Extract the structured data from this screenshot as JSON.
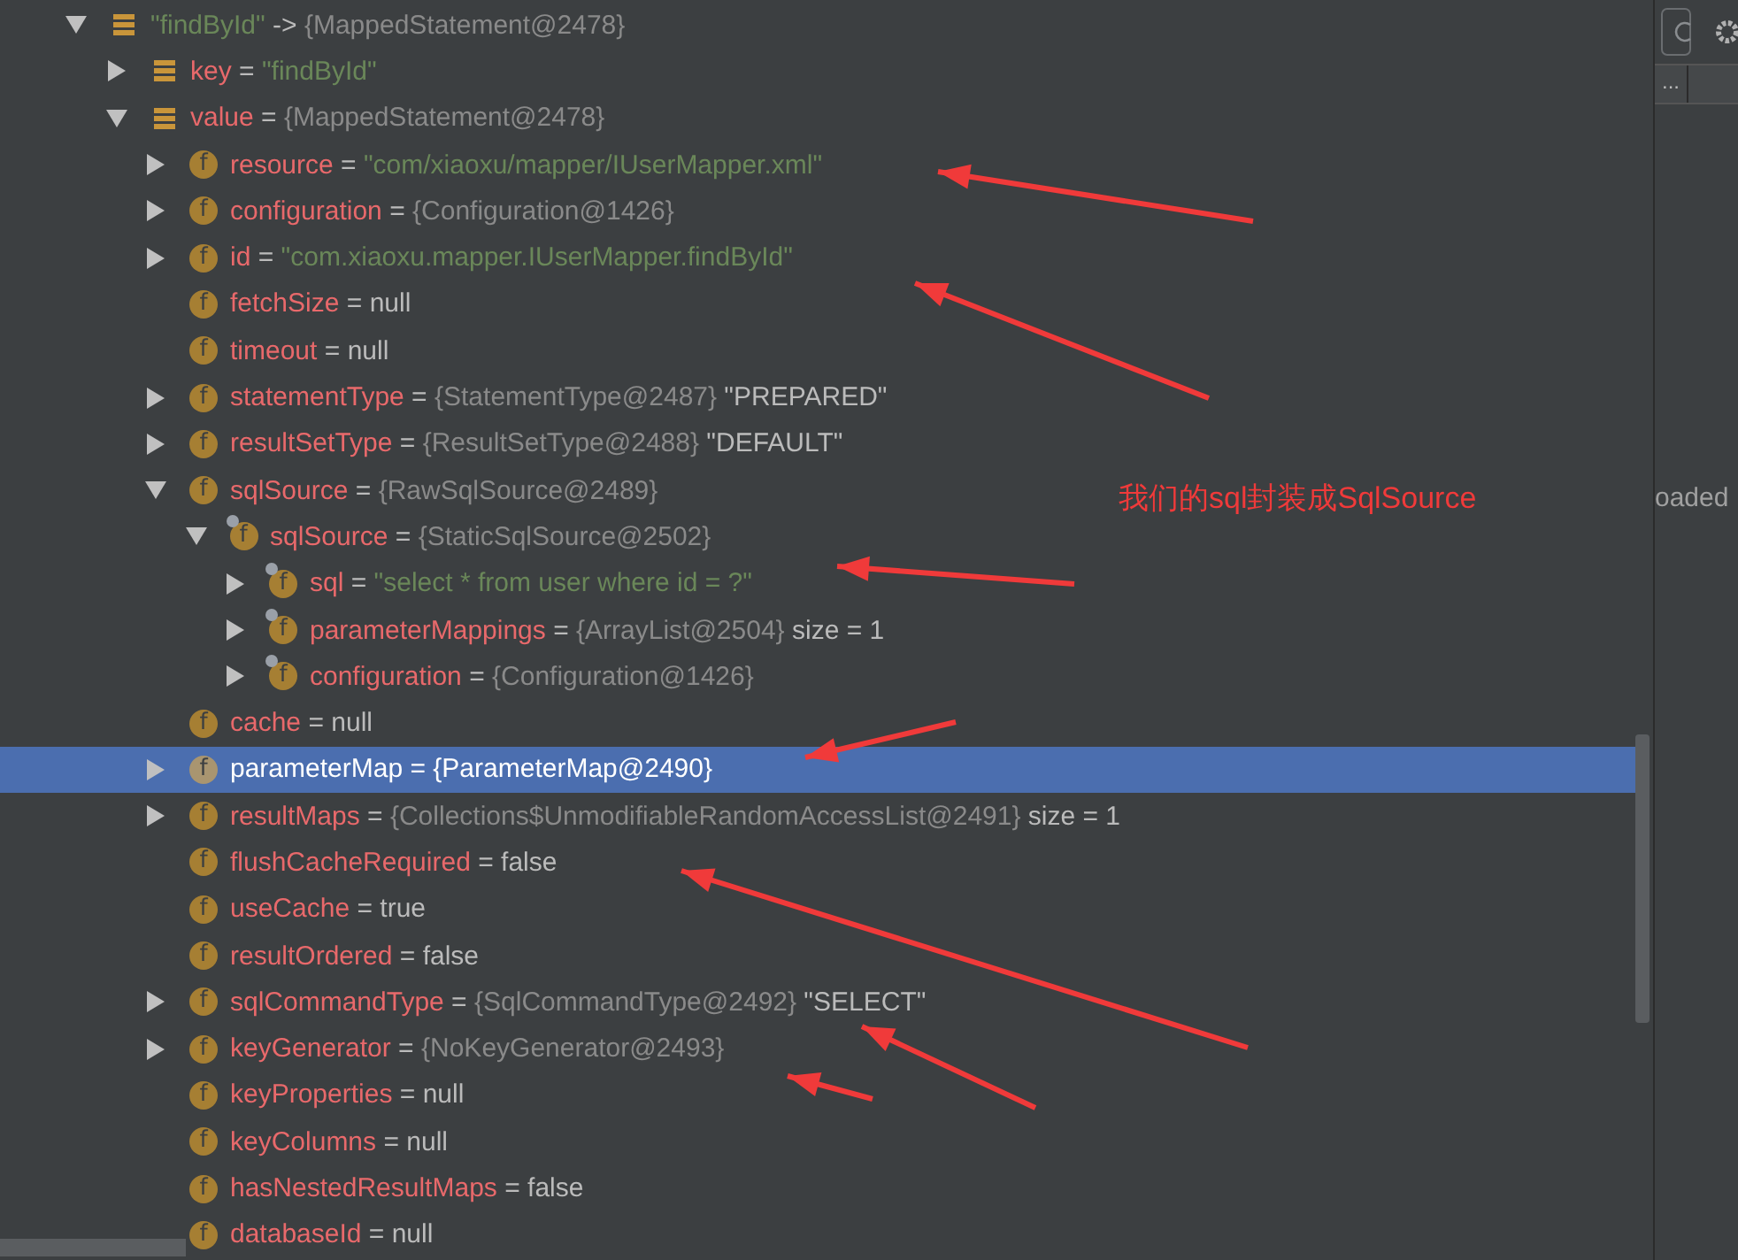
{
  "tree": [
    {
      "key": "\"findById\"",
      "sep": "->",
      "object": "{MappedStatement@2478}",
      "kind": "entry",
      "expanded": true,
      "selected": false,
      "children": [
        {
          "name": "key",
          "sep": "=",
          "string": "\"findById\"",
          "kind": "entry",
          "expanded": false,
          "selected": false
        },
        {
          "name": "value",
          "sep": "=",
          "object": "{MappedStatement@2478}",
          "kind": "entry",
          "expanded": true,
          "selected": false,
          "children": [
            {
              "name": "resource",
              "sep": "=",
              "string": "\"com/xiaoxu/mapper/IUserMapper.xml\"",
              "kind": "field",
              "icon_glyph": "f",
              "expanded": false,
              "selected": false
            },
            {
              "name": "configuration",
              "sep": "=",
              "object": "{Configuration@1426}",
              "kind": "field",
              "icon_glyph": "f",
              "expanded": false,
              "selected": false
            },
            {
              "name": "id",
              "sep": "=",
              "string": "\"com.xiaoxu.mapper.IUserMapper.findById\"",
              "kind": "field",
              "icon_glyph": "f",
              "expanded": false,
              "selected": false
            },
            {
              "name": "fetchSize",
              "sep": "=",
              "value": "null",
              "kind": "field",
              "icon_glyph": "f",
              "selected": false
            },
            {
              "name": "timeout",
              "sep": "=",
              "value": "null",
              "kind": "field",
              "icon_glyph": "f",
              "selected": false
            },
            {
              "name": "statementType",
              "sep": "=",
              "object": "{StatementType@2487}",
              "extra": "\"PREPARED\"",
              "kind": "field",
              "icon_glyph": "f",
              "expanded": false,
              "selected": false
            },
            {
              "name": "resultSetType",
              "sep": "=",
              "object": "{ResultSetType@2488}",
              "extra": "\"DEFAULT\"",
              "kind": "field",
              "icon_glyph": "f",
              "expanded": false,
              "selected": false
            },
            {
              "name": "sqlSource",
              "sep": "=",
              "object": "{RawSqlSource@2489}",
              "kind": "field",
              "icon_glyph": "f",
              "expanded": true,
              "selected": false,
              "children": [
                {
                  "name": "sqlSource",
                  "sep": "=",
                  "object": "{StaticSqlSource@2502}",
                  "kind": "final-field",
                  "icon_glyph": "f",
                  "expanded": true,
                  "selected": false,
                  "children": [
                    {
                      "name": "sql",
                      "sep": "=",
                      "string": "\"select * from user where id = ?\"",
                      "kind": "final-field",
                      "icon_glyph": "f",
                      "expanded": false,
                      "selected": false
                    },
                    {
                      "name": "parameterMappings",
                      "sep": "=",
                      "object": "{ArrayList@2504}",
                      "extra": "size = 1",
                      "kind": "final-field",
                      "icon_glyph": "f",
                      "expanded": false,
                      "selected": false
                    },
                    {
                      "name": "configuration",
                      "sep": "=",
                      "object": "{Configuration@1426}",
                      "kind": "final-field",
                      "icon_glyph": "f",
                      "expanded": false,
                      "selected": false
                    }
                  ]
                }
              ]
            },
            {
              "name": "cache",
              "sep": "=",
              "value": "null",
              "kind": "field",
              "icon_glyph": "f",
              "selected": false
            },
            {
              "name": "parameterMap",
              "sep": "=",
              "object": "{ParameterMap@2490}",
              "kind": "field",
              "icon_glyph": "f",
              "expanded": false,
              "selected": true
            },
            {
              "name": "resultMaps",
              "sep": "=",
              "object": "{Collections$UnmodifiableRandomAccessList@2491}",
              "extra": "size = 1",
              "kind": "field",
              "icon_glyph": "f",
              "expanded": false,
              "selected": false
            },
            {
              "name": "flushCacheRequired",
              "sep": "=",
              "value": "false",
              "kind": "field",
              "icon_glyph": "f",
              "selected": false
            },
            {
              "name": "useCache",
              "sep": "=",
              "value": "true",
              "kind": "field",
              "icon_glyph": "f",
              "selected": false
            },
            {
              "name": "resultOrdered",
              "sep": "=",
              "value": "false",
              "kind": "field",
              "icon_glyph": "f",
              "selected": false
            },
            {
              "name": "sqlCommandType",
              "sep": "=",
              "object": "{SqlCommandType@2492}",
              "extra": "\"SELECT\"",
              "kind": "field",
              "icon_glyph": "f",
              "expanded": false,
              "selected": false
            },
            {
              "name": "keyGenerator",
              "sep": "=",
              "object": "{NoKeyGenerator@2493}",
              "kind": "field",
              "icon_glyph": "f",
              "expanded": false,
              "selected": false
            },
            {
              "name": "keyProperties",
              "sep": "=",
              "value": "null",
              "kind": "field",
              "icon_glyph": "f",
              "selected": false
            },
            {
              "name": "keyColumns",
              "sep": "=",
              "value": "null",
              "kind": "field",
              "icon_glyph": "f",
              "selected": false
            },
            {
              "name": "hasNestedResultMaps",
              "sep": "=",
              "value": "false",
              "kind": "field",
              "icon_glyph": "f",
              "selected": false
            },
            {
              "name": "databaseId",
              "sep": "=",
              "value": "null",
              "kind": "field",
              "icon_glyph": "f",
              "selected": false
            }
          ]
        }
      ]
    }
  ],
  "annotation": "我们的sql封装成SqlSource",
  "side_panel": {
    "tab_label": "...",
    "text": "oaded"
  }
}
